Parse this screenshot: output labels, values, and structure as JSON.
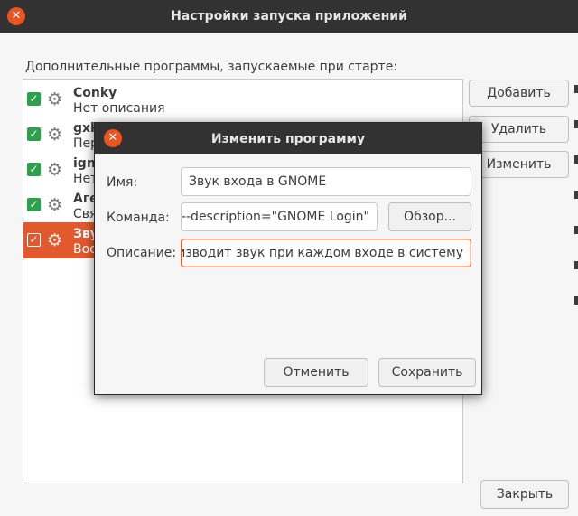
{
  "window": {
    "title": "Настройки запуска приложений",
    "section_label": "Дополнительные программы, запускаемые при старте:",
    "buttons": {
      "add": "Добавить",
      "remove": "Удалить",
      "edit": "Изменить",
      "close": "Закрыть"
    },
    "apps": [
      {
        "name": "Conky",
        "description": "Нет описания",
        "checked": true,
        "selected": false
      },
      {
        "name": "gxk",
        "description": "Пер",
        "checked": true,
        "selected": false
      },
      {
        "name": "ign",
        "description": "Нет",
        "checked": true,
        "selected": false
      },
      {
        "name": "Аге",
        "description": "Свя",
        "checked": true,
        "selected": false
      },
      {
        "name": "Зву",
        "description": "Вос",
        "checked": true,
        "selected": true
      }
    ]
  },
  "dialog": {
    "title": "Изменить программу",
    "name_label": "Имя:",
    "name_value": "Звук входа в GNOME",
    "command_label": "Команда:",
    "command_value": "--description=\"GNOME Login\"",
    "browse_button": "Обзор...",
    "description_label": "Описание:",
    "description_value": "роизводит звук при каждом входе в систему",
    "cancel_button": "Отменить",
    "save_button": "Сохранить"
  },
  "colors": {
    "accent": "#e95420",
    "selection": "#e2592d",
    "check": "#2e9f4a",
    "titlebar": "#323232"
  },
  "icons": {
    "close": "close-icon",
    "app": "gear-icon",
    "check": "checkbox-icon"
  }
}
